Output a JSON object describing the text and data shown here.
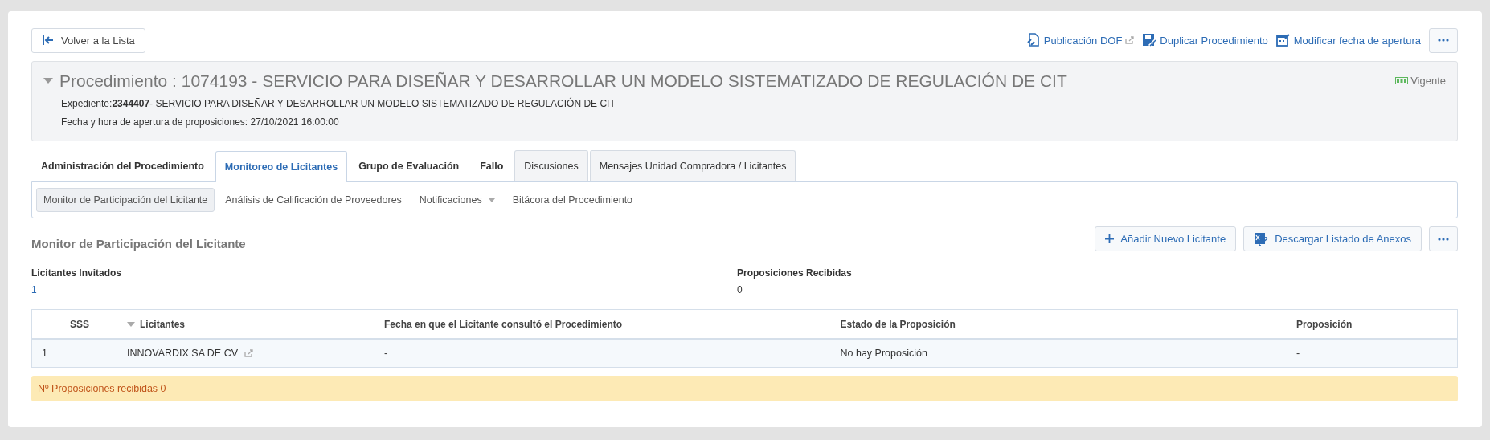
{
  "toolbar": {
    "back_button": "Volver a la Lista",
    "actions": [
      {
        "label": "Publicación DOF",
        "kind": "link-doc",
        "external": true
      },
      {
        "label": "Duplicar Procedimiento",
        "kind": "save-doc",
        "external": false
      },
      {
        "label": "Modificar fecha de apertura",
        "kind": "calendar",
        "external": false
      }
    ]
  },
  "header": {
    "expanded": true,
    "title": "Procedimiento : 1074193 - SERVICIO PARA DISEÑAR Y DESARROLLAR UN MODELO SISTEMATIZADO DE REGULACIÓN DE CIT",
    "expediente": "Expediente:**2344407**- SERVICIO PARA DISEÑAR Y DESARROLLAR UN MODELO SISTEMATIZADO DE REGULACIÓN DE CIT",
    "fecha": "Fecha y hora de apertura de proposiciones: 27/10/2021 16:00:00",
    "status": "Vigente"
  },
  "tabs": [
    {
      "label": "Administración del Procedimiento",
      "kind": "plain",
      "selected": false
    },
    {
      "label": "Monitoreo de Licitantes",
      "kind": "plain",
      "selected": true
    },
    {
      "label": "Grupo de Evaluación",
      "kind": "plain",
      "selected": false
    },
    {
      "label": "Fallo",
      "kind": "plain",
      "selected": false
    },
    {
      "label": "Discusiones",
      "kind": "boxed",
      "selected": false
    },
    {
      "label": "Mensajes Unidad Compradora / Licitantes",
      "kind": "boxed",
      "selected": false
    }
  ],
  "subtabs": [
    {
      "label": "Monitor de Participación del Licitante",
      "selected": true,
      "has_menu": false
    },
    {
      "label": "Análisis de Calificación de Proveedores",
      "selected": false,
      "has_menu": false
    },
    {
      "label": "Notificaciones",
      "selected": false,
      "has_menu": true
    },
    {
      "label": "Bitácora del Procedimiento",
      "selected": false,
      "has_menu": false
    }
  ],
  "section": {
    "title": "Monitor de Participación del Licitante",
    "buttons": [
      {
        "label": "Añadir Nuevo Licitante",
        "kind": "plus"
      },
      {
        "label": "Descargar Listado de Anexos",
        "kind": "excel"
      }
    ]
  },
  "stats": [
    {
      "label": "Licitantes Invitados",
      "value": "1",
      "kind": "link"
    },
    {
      "label": "Proposiciones Recibidas",
      "value": "0",
      "kind": "plain"
    }
  ],
  "table": {
    "columns": [
      {
        "label": "SSS",
        "sorted": false
      },
      {
        "label": "Licitantes",
        "sorted": true
      },
      {
        "label": "Fecha en que el Licitante consultó el Procedimiento",
        "sorted": false
      },
      {
        "label": "Estado de la Proposición",
        "sorted": false
      },
      {
        "label": "Proposición",
        "sorted": false
      }
    ],
    "rows": [
      {
        "cells": [
          "1",
          "INNOVARDIX SA DE CV",
          "-",
          "No hay Proposición",
          "-"
        ],
        "external": true
      }
    ]
  },
  "alert": "Nº Proposiciones recibidas 0"
}
